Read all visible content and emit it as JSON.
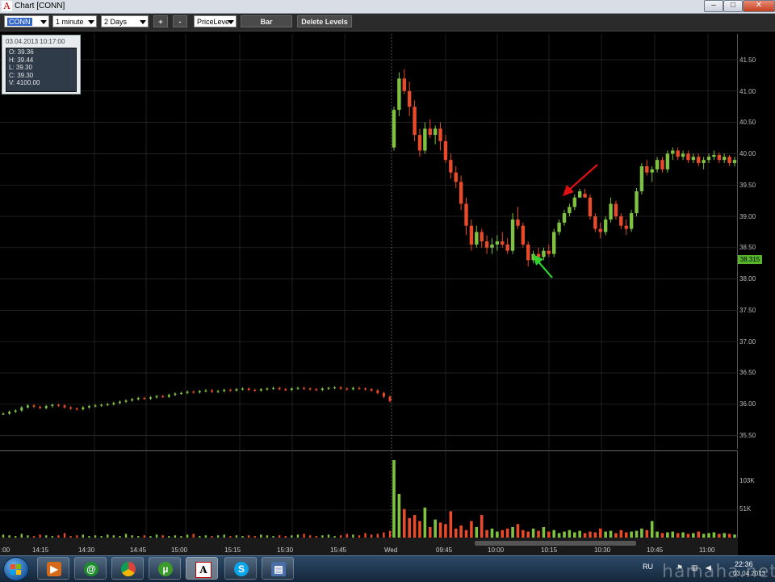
{
  "window": {
    "title": "Chart [CONN]",
    "logo": "A",
    "controls": [
      "minimize",
      "maximize",
      "close"
    ],
    "control_glyphs": {
      "minimize": "–",
      "maximize": "□",
      "close": "✕"
    }
  },
  "toolbar": {
    "symbol": "CONN",
    "interval": "1 minute",
    "range": "2 Days",
    "zoom_in": "+",
    "zoom_out": "-",
    "levels_mode": "PriceLeve",
    "chart_type": "Bar",
    "delete_levels": "Delete Levels"
  },
  "info_box": {
    "datetime": "03.04.2013 10:17:00",
    "open": "O: 39.36",
    "high": "H: 39.44",
    "low": "L: 39.30",
    "close": "C: 39.30",
    "volume": "V: 4100.00"
  },
  "price_axis": {
    "labels": [
      "41.50",
      "41.00",
      "40.50",
      "40.00",
      "39.50",
      "39.00",
      "38.50",
      "38.00",
      "37.50",
      "37.00",
      "36.50",
      "36.00",
      "35.50"
    ],
    "last_price": "38.315"
  },
  "volume_axis": {
    "labels": [
      "103K",
      "51K"
    ]
  },
  "time_axis": {
    "labels": [
      ":00",
      "14:15",
      "14:30",
      "14:45",
      "15:00",
      "15:15",
      "15:30",
      "15:45",
      "Wed",
      "09:45",
      "10:00",
      "10:15",
      "10:30",
      "10:45",
      "11:00"
    ]
  },
  "colors": {
    "up": "#7fc241",
    "down": "#e84a2a",
    "grid": "#2d2d2d",
    "annotation_down_arrow": "#e01010",
    "annotation_up_arrow": "#2fd02f"
  },
  "chart_data": {
    "type": "bar",
    "symbol": "CONN",
    "interval": "1 minute",
    "ylim": [
      35.3,
      41.9
    ],
    "grid": true,
    "legend": "none",
    "day1_closes": [
      35.85,
      35.88,
      35.9,
      35.95,
      35.98,
      35.96,
      35.94,
      35.97,
      35.99,
      35.98,
      35.95,
      35.93,
      35.92,
      35.95,
      35.97,
      35.98,
      35.99,
      36.0,
      36.02,
      36.04,
      36.06,
      36.08,
      36.1,
      36.09,
      36.11,
      36.13,
      36.12,
      36.15,
      36.17,
      36.18,
      36.2,
      36.19,
      36.21,
      36.22,
      36.2,
      36.21,
      36.23,
      36.22,
      36.24,
      36.25,
      36.23,
      36.22,
      36.24,
      36.25,
      36.26,
      36.24,
      36.23,
      36.25,
      36.26,
      36.25,
      36.24,
      36.23,
      36.25,
      36.26,
      36.27,
      36.25,
      36.24,
      36.26,
      36.25,
      36.24,
      36.22,
      36.18,
      36.12,
      36.05
    ],
    "day2_ohlc": [
      [
        40.1,
        40.75,
        40.05,
        40.7
      ],
      [
        40.7,
        41.3,
        40.6,
        41.2
      ],
      [
        41.2,
        41.35,
        40.95,
        41.0
      ],
      [
        41.0,
        41.15,
        40.6,
        40.75
      ],
      [
        40.75,
        40.85,
        40.2,
        40.3
      ],
      [
        40.3,
        40.4,
        39.95,
        40.05
      ],
      [
        40.05,
        40.5,
        40.0,
        40.4
      ],
      [
        40.4,
        40.55,
        40.25,
        40.3
      ],
      [
        40.3,
        40.45,
        40.15,
        40.4
      ],
      [
        40.4,
        40.5,
        40.05,
        40.2
      ],
      [
        40.2,
        40.3,
        39.85,
        39.9
      ],
      [
        39.9,
        40.0,
        39.6,
        39.7
      ],
      [
        39.7,
        39.8,
        39.45,
        39.55
      ],
      [
        39.55,
        39.65,
        39.1,
        39.2
      ],
      [
        39.2,
        39.3,
        38.7,
        38.85
      ],
      [
        38.85,
        38.95,
        38.45,
        38.55
      ],
      [
        38.55,
        38.85,
        38.5,
        38.75
      ],
      [
        38.75,
        38.8,
        38.5,
        38.6
      ],
      [
        38.6,
        38.7,
        38.4,
        38.5
      ],
      [
        38.5,
        38.65,
        38.4,
        38.55
      ],
      [
        38.55,
        38.7,
        38.45,
        38.6
      ],
      [
        38.6,
        38.75,
        38.5,
        38.55
      ],
      [
        38.55,
        38.65,
        38.4,
        38.45
      ],
      [
        38.45,
        39.05,
        38.4,
        38.95
      ],
      [
        38.95,
        39.15,
        38.8,
        38.85
      ],
      [
        38.85,
        38.9,
        38.5,
        38.55
      ],
      [
        38.55,
        38.6,
        38.2,
        38.3
      ],
      [
        38.3,
        38.45,
        38.25,
        38.4
      ],
      [
        38.4,
        38.5,
        38.3,
        38.35
      ],
      [
        38.35,
        38.5,
        38.3,
        38.45
      ],
      [
        38.45,
        38.55,
        38.35,
        38.4
      ],
      [
        38.4,
        38.8,
        38.35,
        38.75
      ],
      [
        38.75,
        38.95,
        38.7,
        38.9
      ],
      [
        38.9,
        39.1,
        38.85,
        39.05
      ],
      [
        39.05,
        39.2,
        39.0,
        39.15
      ],
      [
        39.15,
        39.35,
        39.1,
        39.3
      ],
      [
        39.3,
        39.44,
        39.3,
        39.4
      ],
      [
        39.36,
        39.44,
        39.3,
        39.3
      ],
      [
        39.3,
        39.35,
        38.95,
        39.0
      ],
      [
        39.0,
        39.05,
        38.75,
        38.8
      ],
      [
        38.8,
        38.9,
        38.65,
        38.75
      ],
      [
        38.75,
        39.0,
        38.7,
        38.95
      ],
      [
        38.95,
        39.3,
        38.9,
        39.2
      ],
      [
        39.2,
        39.25,
        38.95,
        39.0
      ],
      [
        39.0,
        39.05,
        38.8,
        38.85
      ],
      [
        38.85,
        38.95,
        38.7,
        38.8
      ],
      [
        38.8,
        39.1,
        38.75,
        39.05
      ],
      [
        39.05,
        39.45,
        39.0,
        39.4
      ],
      [
        39.4,
        39.85,
        39.35,
        39.8
      ],
      [
        39.8,
        39.9,
        39.65,
        39.7
      ],
      [
        39.7,
        39.8,
        39.55,
        39.75
      ],
      [
        39.75,
        39.95,
        39.7,
        39.9
      ],
      [
        39.9,
        39.95,
        39.7,
        39.75
      ],
      [
        39.75,
        40.05,
        39.7,
        40.0
      ],
      [
        40.0,
        40.1,
        39.9,
        40.05
      ],
      [
        40.05,
        40.1,
        39.9,
        39.95
      ],
      [
        39.95,
        40.05,
        39.9,
        40.0
      ],
      [
        40.0,
        40.05,
        39.85,
        39.9
      ],
      [
        39.9,
        40.0,
        39.85,
        39.95
      ],
      [
        39.95,
        40.0,
        39.8,
        39.85
      ],
      [
        39.85,
        39.95,
        39.75,
        39.9
      ],
      [
        39.9,
        40.0,
        39.85,
        39.95
      ],
      [
        39.95,
        40.05,
        39.9,
        39.98
      ],
      [
        39.98,
        40.02,
        39.85,
        39.9
      ],
      [
        39.9,
        40.0,
        39.85,
        39.95
      ],
      [
        39.95,
        39.98,
        39.8,
        39.85
      ],
      [
        39.85,
        39.95,
        39.8,
        39.9
      ]
    ],
    "volume_day1": [
      4,
      3,
      2,
      5,
      3,
      2,
      4,
      3,
      2,
      3,
      6,
      2,
      3,
      4,
      2,
      3,
      2,
      4,
      3,
      2,
      5,
      3,
      2,
      3,
      2,
      4,
      3,
      2,
      3,
      2,
      4,
      5,
      2,
      3,
      2,
      3,
      4,
      2,
      3,
      2,
      3,
      2,
      4,
      3,
      2,
      3,
      2,
      3,
      4,
      5,
      3,
      2,
      3,
      4,
      2,
      3,
      5,
      4,
      3,
      6,
      4,
      5,
      7,
      9
    ],
    "volume_day2": [
      103,
      58,
      38,
      26,
      30,
      22,
      40,
      14,
      24,
      20,
      18,
      35,
      12,
      16,
      10,
      22,
      14,
      30,
      10,
      12,
      8,
      10,
      12,
      14,
      18,
      10,
      8,
      12,
      9,
      14,
      8,
      10,
      6,
      8,
      10,
      7,
      9,
      6,
      8,
      7,
      12,
      8,
      9,
      6,
      10,
      7,
      8,
      9,
      12,
      10,
      22,
      8,
      6,
      7,
      8,
      6,
      7,
      5,
      6,
      8,
      5,
      6,
      7,
      5,
      6,
      5,
      4
    ],
    "volume_units": "K"
  }
}
